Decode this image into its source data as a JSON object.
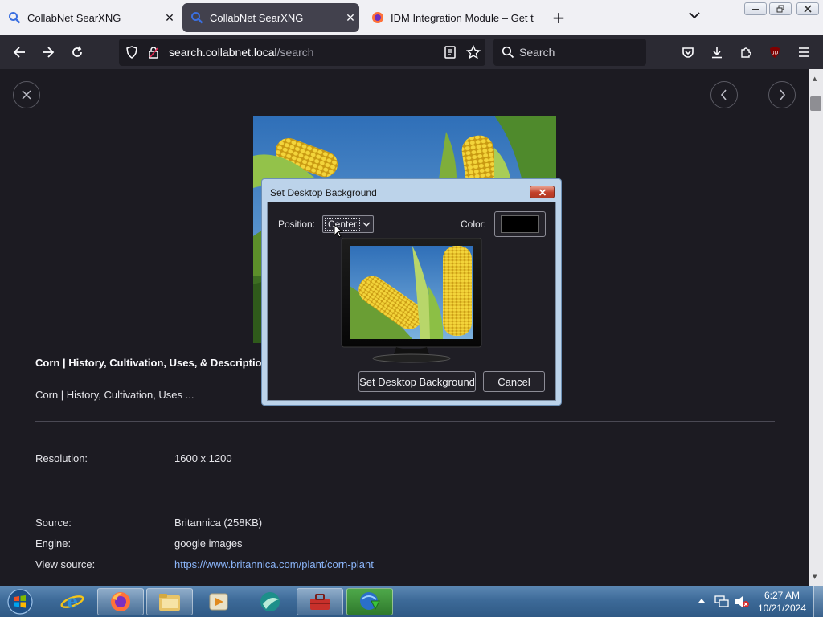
{
  "browser": {
    "tabs": [
      {
        "title": "CollabNet SearXNG",
        "icon": "search-icon",
        "active": false
      },
      {
        "title": "CollabNet SearXNG",
        "icon": "search-icon",
        "active": true
      },
      {
        "title": "IDM Integration Module – Get t",
        "icon": "firefox-icon",
        "active": false
      }
    ],
    "new_tab_symbol": "+",
    "url": {
      "host": "search.collabnet.local",
      "path": "/search"
    },
    "search_placeholder": "Search"
  },
  "result": {
    "title": "Corn | History, Cultivation, Uses, & Description",
    "subtitle": "Corn | History, Cultivation, Uses ...",
    "fields": [
      {
        "label": "Resolution:",
        "value": "1600 x 1200"
      },
      {
        "label": "Source:",
        "value": "Britannica (258KB)"
      },
      {
        "label": "Engine:",
        "value": "google images"
      },
      {
        "label": "View source:",
        "value": "https://www.britannica.com/plant/corn-plant"
      }
    ]
  },
  "dialog": {
    "title": "Set Desktop Background",
    "position_label": "Position:",
    "position_value": "Center",
    "color_label": "Color:",
    "color_value": "#000000",
    "ok_label": "Set Desktop Background",
    "cancel_label": "Cancel"
  },
  "taskbar": {
    "time": "6:27 AM",
    "date": "10/21/2024"
  },
  "colors": {
    "link": "#8ab4f8",
    "sky": "#3f86c8",
    "corn": "#e8c62a"
  }
}
